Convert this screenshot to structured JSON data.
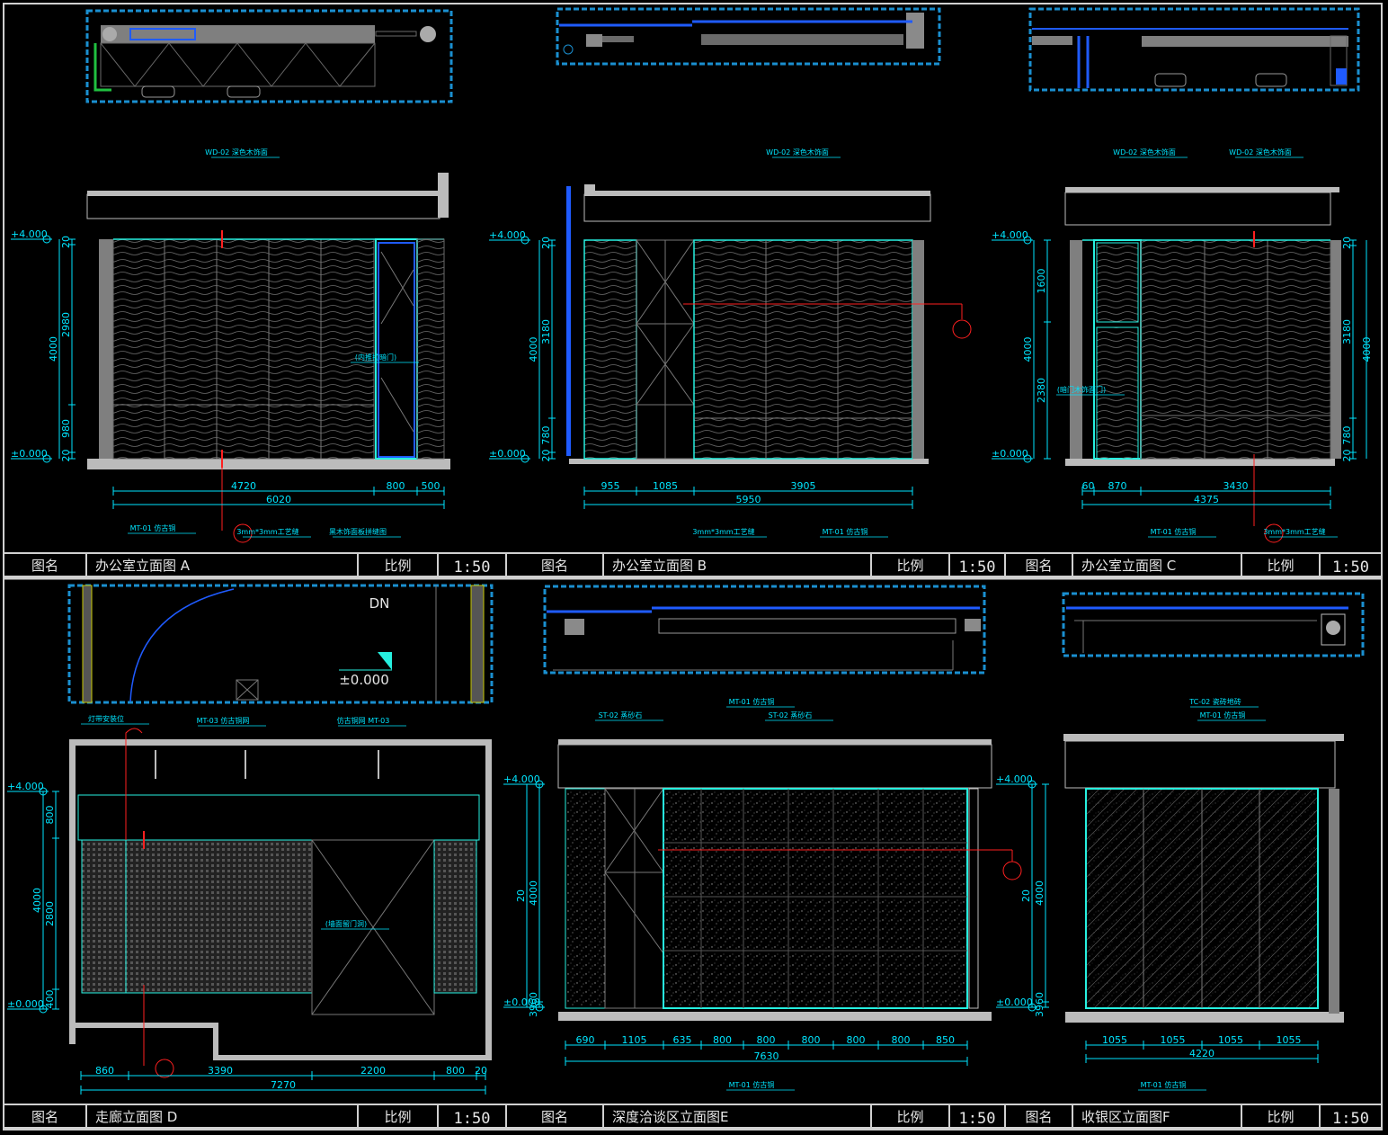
{
  "title_bar_labels": {
    "name": "图名",
    "scale": "比例"
  },
  "panels": [
    {
      "id": "A",
      "title": "办公室立面图 A",
      "scale": "1:50",
      "level_top": "+4.000",
      "level_bottom": "±0.000",
      "vert_dims_left": [
        "20",
        "2980",
        "980",
        "20",
        "4000"
      ],
      "horiz_dims_row1": [
        "4720",
        "800",
        "500"
      ],
      "horiz_dims_row2": [
        "6020"
      ],
      "callouts": [
        "WD-02 深色木饰面",
        "MT-01 仿古铜",
        "3mm*3mm工艺缝",
        "黑木饰面板拼缝图",
        "(内推拉暗门)"
      ]
    },
    {
      "id": "B",
      "title": "办公室立面图 B",
      "scale": "1:50",
      "level_top": "+4.000",
      "level_bottom": "±0.000",
      "vert_dims_left": [
        "20",
        "3180",
        "780",
        "20",
        "4000"
      ],
      "horiz_dims_row1": [
        "955",
        "1085",
        "3905"
      ],
      "horiz_dims_row2": [
        "5950"
      ],
      "callouts": [
        "WD-02 深色木饰面",
        "MT-01 仿古铜",
        "3mm*3mm工艺缝"
      ]
    },
    {
      "id": "C",
      "title": "办公室立面图 C",
      "scale": "1:50",
      "level_top": "+4.000",
      "level_bottom": "±0.000",
      "vert_dims_left": [
        "1600",
        "2380",
        "4000"
      ],
      "vert_dims_right": [
        "20",
        "3180",
        "780",
        "20",
        "4000"
      ],
      "horiz_dims_row1": [
        "60",
        "870",
        "3430"
      ],
      "horiz_dims_row2": [
        "4375"
      ],
      "callouts": [
        "WD-02 深色木饰面",
        "WD-02 深色木饰面",
        "MT-01 仿古铜",
        "3mm*3mm工艺缝",
        "(暗门木饰面门)"
      ]
    },
    {
      "id": "D",
      "title": "走廊立面图 D",
      "scale": "1:50",
      "level_top": "+4.000",
      "level_bottom": "±0.000",
      "vert_dims_left": [
        "800",
        "2800",
        "400",
        "4000"
      ],
      "horiz_dims_row1": [
        "860",
        "3390",
        "2200",
        "800",
        "20"
      ],
      "horiz_dims_row2": [
        "7270"
      ],
      "callouts": [
        "MT-03 仿古铜网",
        "仿古铜网 MT-03",
        "(墙面留门洞)",
        "灯带安装位"
      ],
      "plan_text": [
        "DN",
        "±0.000"
      ]
    },
    {
      "id": "E",
      "title": "深度洽谈区立面图E",
      "scale": "1:50",
      "level_top": "+4.000",
      "level_bottom": "±0.000",
      "vert_dims_left": [
        "4000",
        "3960",
        "20"
      ],
      "horiz_dims_row1": [
        "690",
        "1105",
        "635",
        "800",
        "800",
        "800",
        "800",
        "800",
        "850"
      ],
      "horiz_dims_row2": [
        "7630"
      ],
      "callouts": [
        "ST-02 蒸砂石",
        "MT-01 仿古铜",
        "ST-02 蒸砂石",
        "MT-01 仿古铜"
      ]
    },
    {
      "id": "F",
      "title": "收银区立面图F",
      "scale": "1:50",
      "level_top": "+4.000",
      "level_bottom": "±0.000",
      "vert_dims_left": [
        "4000",
        "3960",
        "20"
      ],
      "horiz_dims_row1": [
        "1055",
        "1055",
        "1055",
        "1055"
      ],
      "horiz_dims_row2": [
        "4220"
      ],
      "callouts": [
        "TC-02 瓷砖地砖",
        "MT-01 仿古铜",
        "MT-01 仿古铜"
      ]
    }
  ],
  "colors": {
    "background": "#000000",
    "frame": "#d0d0d0",
    "dimension": "#00e5ff",
    "plan_border": "#1a8fd0",
    "wall": "#7f7f7f",
    "panel_edge": "#26f0e0",
    "leader_red": "#ff2020",
    "texture": "#5a5a5a"
  }
}
